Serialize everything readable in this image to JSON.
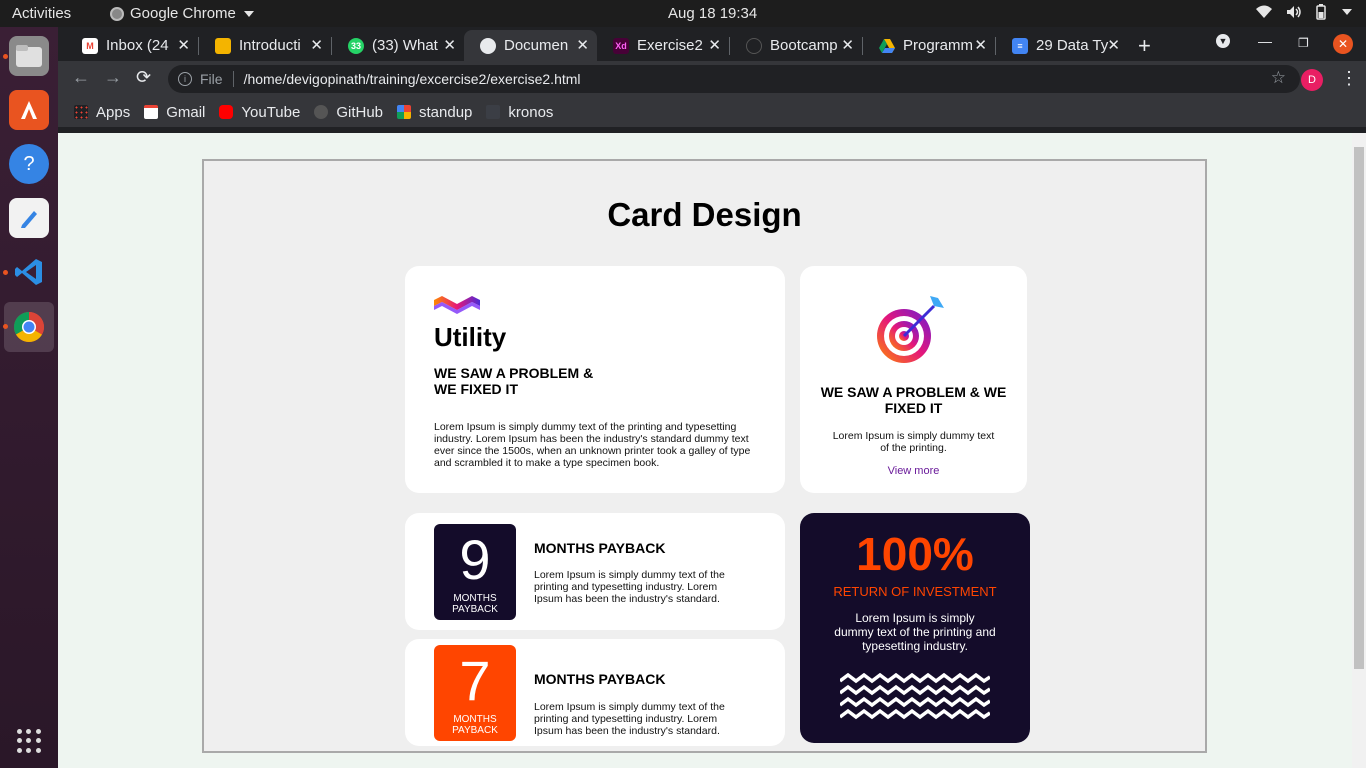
{
  "system": {
    "activities": "Activities",
    "app_name": "Google Chrome",
    "clock": "Aug 18  19:34"
  },
  "browser": {
    "tabs": [
      {
        "label": "Inbox (24",
        "favicon": "gmail-icon",
        "color": "#ea4335"
      },
      {
        "label": "Introducti",
        "favicon": "slides-icon",
        "color": "#f4b400"
      },
      {
        "label": "(33) What",
        "favicon": "whatsapp-icon",
        "color": "#25d366"
      },
      {
        "label": "Documen",
        "favicon": "globe-icon",
        "color": "#e8eaed",
        "active": true
      },
      {
        "label": "Exercise2",
        "favicon": "xd-icon",
        "color": "#470137"
      },
      {
        "label": "Bootcamp",
        "favicon": "github-icon",
        "color": "#202124"
      },
      {
        "label": "Programm",
        "favicon": "drive-icon",
        "color": "#0f9d58"
      },
      {
        "label": "29 Data Ty",
        "favicon": "docs-icon",
        "color": "#4285f4"
      }
    ],
    "address": {
      "scheme_label": "File",
      "url": "/home/devigopinath/training/excercise2/exercise2.html"
    },
    "profile_initial": "D",
    "bookmarks": [
      {
        "label": "Apps",
        "icon": "apps-grid-icon"
      },
      {
        "label": "Gmail",
        "icon": "gmail-icon"
      },
      {
        "label": "YouTube",
        "icon": "youtube-icon"
      },
      {
        "label": "GitHub",
        "icon": "github-icon"
      },
      {
        "label": "standup",
        "icon": "meet-icon"
      },
      {
        "label": "kronos",
        "icon": "kronos-icon"
      }
    ]
  },
  "page": {
    "title": "Card Design",
    "utility_card": {
      "title": "Utility",
      "headline": "WE SAW A PROBLEM & WE FIXED IT",
      "body": "Lorem Ipsum is simply dummy text of the printing and typesetting industry. Lorem Ipsum has been the industry's standard dummy text ever since the 1500s, when an unknown printer took a galley of type and scrambled it to make a type specimen book."
    },
    "target_card": {
      "headline": "WE SAW A PROBLEM & WE FIXED IT",
      "body": "Lorem Ipsum is simply dummy text of the printing.",
      "link": "View more"
    },
    "payback_cards": [
      {
        "number": "9",
        "caption": "MONTHS PAYBACK",
        "title": "MONTHS PAYBACK",
        "body": "Lorem Ipsum is simply dummy text of the printing and typesetting industry. Lorem Ipsum has been the industry's standard.",
        "color": "#140c2a"
      },
      {
        "number": "7",
        "caption": "MONTHS PAYBACK",
        "title": "MONTHS PAYBACK",
        "body": "Lorem Ipsum is simply dummy text of the printing and typesetting industry. Lorem Ipsum has been the industry's standard.",
        "color": "#ff4500"
      }
    ],
    "roi_card": {
      "percent": "100%",
      "label": "RETURN OF INVESTMENT",
      "body": "Lorem Ipsum is simply dummy text of the printing and typesetting industry."
    }
  },
  "colors": {
    "accent_orange": "#ff4500",
    "dark_navy": "#140c2a",
    "link_purple": "#6a1b9a"
  }
}
